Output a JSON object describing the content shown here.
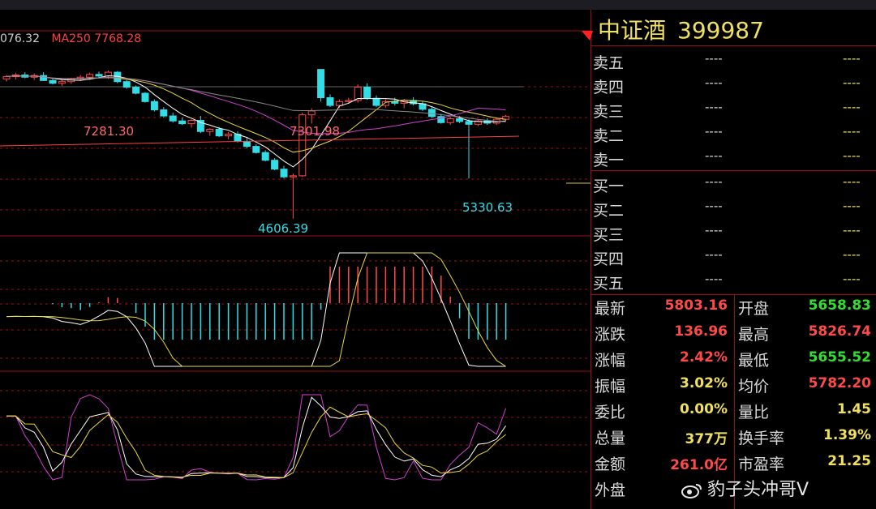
{
  "ma_legend": [
    {
      "text": "076.32",
      "color": "#cfcfcf"
    },
    {
      "text": "MA250 7768.28",
      "color": "#ff4040"
    }
  ],
  "price_labels": {
    "high1": "7281.30",
    "high2": "7301.98",
    "low1": "4606.39",
    "low2": "5330.63"
  },
  "stock": {
    "name": "中证酒",
    "code": "399987"
  },
  "order_book": {
    "sell": [
      {
        "label": "卖五",
        "price": "----",
        "volume": "----"
      },
      {
        "label": "卖四",
        "price": "----",
        "volume": "----"
      },
      {
        "label": "卖三",
        "price": "----",
        "volume": "----"
      },
      {
        "label": "卖二",
        "price": "----",
        "volume": "----"
      },
      {
        "label": "卖一",
        "price": "----",
        "volume": "----"
      }
    ],
    "buy": [
      {
        "label": "买一",
        "price": "----",
        "volume": "----"
      },
      {
        "label": "买二",
        "price": "----",
        "volume": "----"
      },
      {
        "label": "买三",
        "price": "----",
        "volume": "----"
      },
      {
        "label": "买四",
        "price": "----",
        "volume": "----"
      },
      {
        "label": "买五",
        "price": "----",
        "volume": "----"
      }
    ]
  },
  "stats_left": [
    {
      "label": "最新",
      "value": "5803.16",
      "color": "#ff4a4a"
    },
    {
      "label": "涨跌",
      "value": "136.96",
      "color": "#ff4a4a"
    },
    {
      "label": "涨幅",
      "value": "2.42%",
      "color": "#ff4a4a"
    },
    {
      "label": "振幅",
      "value": "3.02%",
      "color": "#f0e060"
    },
    {
      "label": "委比",
      "value": "0.00%",
      "color": "#f0e060"
    },
    {
      "label": "总量",
      "value": "377万",
      "color": "#f0e060"
    },
    {
      "label": "金额",
      "value": "261.0亿",
      "color": "#ff4a4a"
    },
    {
      "label": "外盘",
      "value": "",
      "color": "#f0e060"
    }
  ],
  "stats_right": [
    {
      "label": "开盘",
      "value": "5658.83",
      "color": "#33dd33"
    },
    {
      "label": "最高",
      "value": "5826.74",
      "color": "#ff4a4a"
    },
    {
      "label": "最低",
      "value": "5655.52",
      "color": "#33dd33"
    },
    {
      "label": "均价",
      "value": "5782.20",
      "color": "#ff4a4a"
    },
    {
      "label": "量比",
      "value": "1.45",
      "color": "#f0e060"
    },
    {
      "label": "换手率",
      "value": "1.39%",
      "color": "#f0e060"
    },
    {
      "label": "市盈率",
      "value": "21.25",
      "color": "#f0e060"
    }
  ],
  "watermark": "豹子头冲哥V",
  "colors": {
    "up": "#ff4a4a",
    "down": "#33dde6",
    "accent": "#f0e060",
    "grid": "#9b1010"
  },
  "candles": [
    {
      "o": 7130,
      "h": 7200,
      "l": 7080,
      "c": 7170
    },
    {
      "o": 7170,
      "h": 7240,
      "l": 7120,
      "c": 7200
    },
    {
      "o": 7200,
      "h": 7250,
      "l": 7140,
      "c": 7160
    },
    {
      "o": 7160,
      "h": 7230,
      "l": 7110,
      "c": 7190
    },
    {
      "o": 7190,
      "h": 7250,
      "l": 7090,
      "c": 7100
    },
    {
      "o": 7100,
      "h": 7150,
      "l": 7030,
      "c": 7050
    },
    {
      "o": 7050,
      "h": 7120,
      "l": 7000,
      "c": 7080
    },
    {
      "o": 7080,
      "h": 7150,
      "l": 7040,
      "c": 7130
    },
    {
      "o": 7130,
      "h": 7200,
      "l": 7090,
      "c": 7160
    },
    {
      "o": 7160,
      "h": 7240,
      "l": 7110,
      "c": 7210
    },
    {
      "o": 7210,
      "h": 7260,
      "l": 7150,
      "c": 7180
    },
    {
      "o": 7180,
      "h": 7281.3,
      "l": 7130,
      "c": 7250
    },
    {
      "o": 7250,
      "h": 7270,
      "l": 7050,
      "c": 7080
    },
    {
      "o": 7080,
      "h": 7110,
      "l": 6950,
      "c": 6980
    },
    {
      "o": 6980,
      "h": 7010,
      "l": 6850,
      "c": 6870
    },
    {
      "o": 6870,
      "h": 6890,
      "l": 6700,
      "c": 6720
    },
    {
      "o": 6720,
      "h": 6760,
      "l": 6540,
      "c": 6570
    },
    {
      "o": 6570,
      "h": 6620,
      "l": 6430,
      "c": 6460
    },
    {
      "o": 6460,
      "h": 6520,
      "l": 6340,
      "c": 6370
    },
    {
      "o": 6370,
      "h": 6430,
      "l": 6300,
      "c": 6320
    },
    {
      "o": 6320,
      "h": 6400,
      "l": 6250,
      "c": 6380
    },
    {
      "o": 6380,
      "h": 6460,
      "l": 6150,
      "c": 6180
    },
    {
      "o": 6180,
      "h": 6240,
      "l": 6100,
      "c": 6220
    },
    {
      "o": 6220,
      "h": 6260,
      "l": 6080,
      "c": 6100
    },
    {
      "o": 6100,
      "h": 6170,
      "l": 6040,
      "c": 6130
    },
    {
      "o": 6130,
      "h": 6180,
      "l": 5980,
      "c": 6000
    },
    {
      "o": 6000,
      "h": 6060,
      "l": 5880,
      "c": 5910
    },
    {
      "o": 5910,
      "h": 5950,
      "l": 5780,
      "c": 5800
    },
    {
      "o": 5800,
      "h": 5840,
      "l": 5640,
      "c": 5660
    },
    {
      "o": 5660,
      "h": 5700,
      "l": 5480,
      "c": 5500
    },
    {
      "o": 5500,
      "h": 5560,
      "l": 5330,
      "c": 5360
    },
    {
      "o": 5360,
      "h": 5420,
      "l": 4606.39,
      "c": 5380
    },
    {
      "o": 5380,
      "h": 6520,
      "l": 5360,
      "c": 6480
    },
    {
      "o": 6480,
      "h": 6600,
      "l": 6320,
      "c": 6550
    },
    {
      "o": 7300,
      "h": 7301.98,
      "l": 6720,
      "c": 6790
    },
    {
      "o": 6790,
      "h": 6850,
      "l": 6620,
      "c": 6650
    },
    {
      "o": 6650,
      "h": 6760,
      "l": 6600,
      "c": 6720
    },
    {
      "o": 6720,
      "h": 6790,
      "l": 6680,
      "c": 6740
    },
    {
      "o": 6740,
      "h": 7030,
      "l": 6700,
      "c": 6980
    },
    {
      "o": 6980,
      "h": 7050,
      "l": 6750,
      "c": 6780
    },
    {
      "o": 6780,
      "h": 6830,
      "l": 6620,
      "c": 6650
    },
    {
      "o": 6650,
      "h": 6760,
      "l": 6610,
      "c": 6720
    },
    {
      "o": 6720,
      "h": 6790,
      "l": 6650,
      "c": 6690
    },
    {
      "o": 6690,
      "h": 6770,
      "l": 6600,
      "c": 6740
    },
    {
      "o": 6740,
      "h": 6800,
      "l": 6650,
      "c": 6680
    },
    {
      "o": 6680,
      "h": 6720,
      "l": 6550,
      "c": 6580
    },
    {
      "o": 6580,
      "h": 6620,
      "l": 6420,
      "c": 6450
    },
    {
      "o": 6450,
      "h": 6500,
      "l": 6320,
      "c": 6340
    },
    {
      "o": 6340,
      "h": 6440,
      "l": 6300,
      "c": 6410
    },
    {
      "o": 6410,
      "h": 6460,
      "l": 6330,
      "c": 6360
    },
    {
      "o": 6360,
      "h": 6400,
      "l": 5330.63,
      "c": 6310
    },
    {
      "o": 6310,
      "h": 6390,
      "l": 6280,
      "c": 6370
    },
    {
      "o": 6370,
      "h": 6420,
      "l": 6300,
      "c": 6330
    },
    {
      "o": 6330,
      "h": 6420,
      "l": 6300,
      "c": 6400
    },
    {
      "o": 6400,
      "h": 6480,
      "l": 6370,
      "c": 6450
    }
  ]
}
